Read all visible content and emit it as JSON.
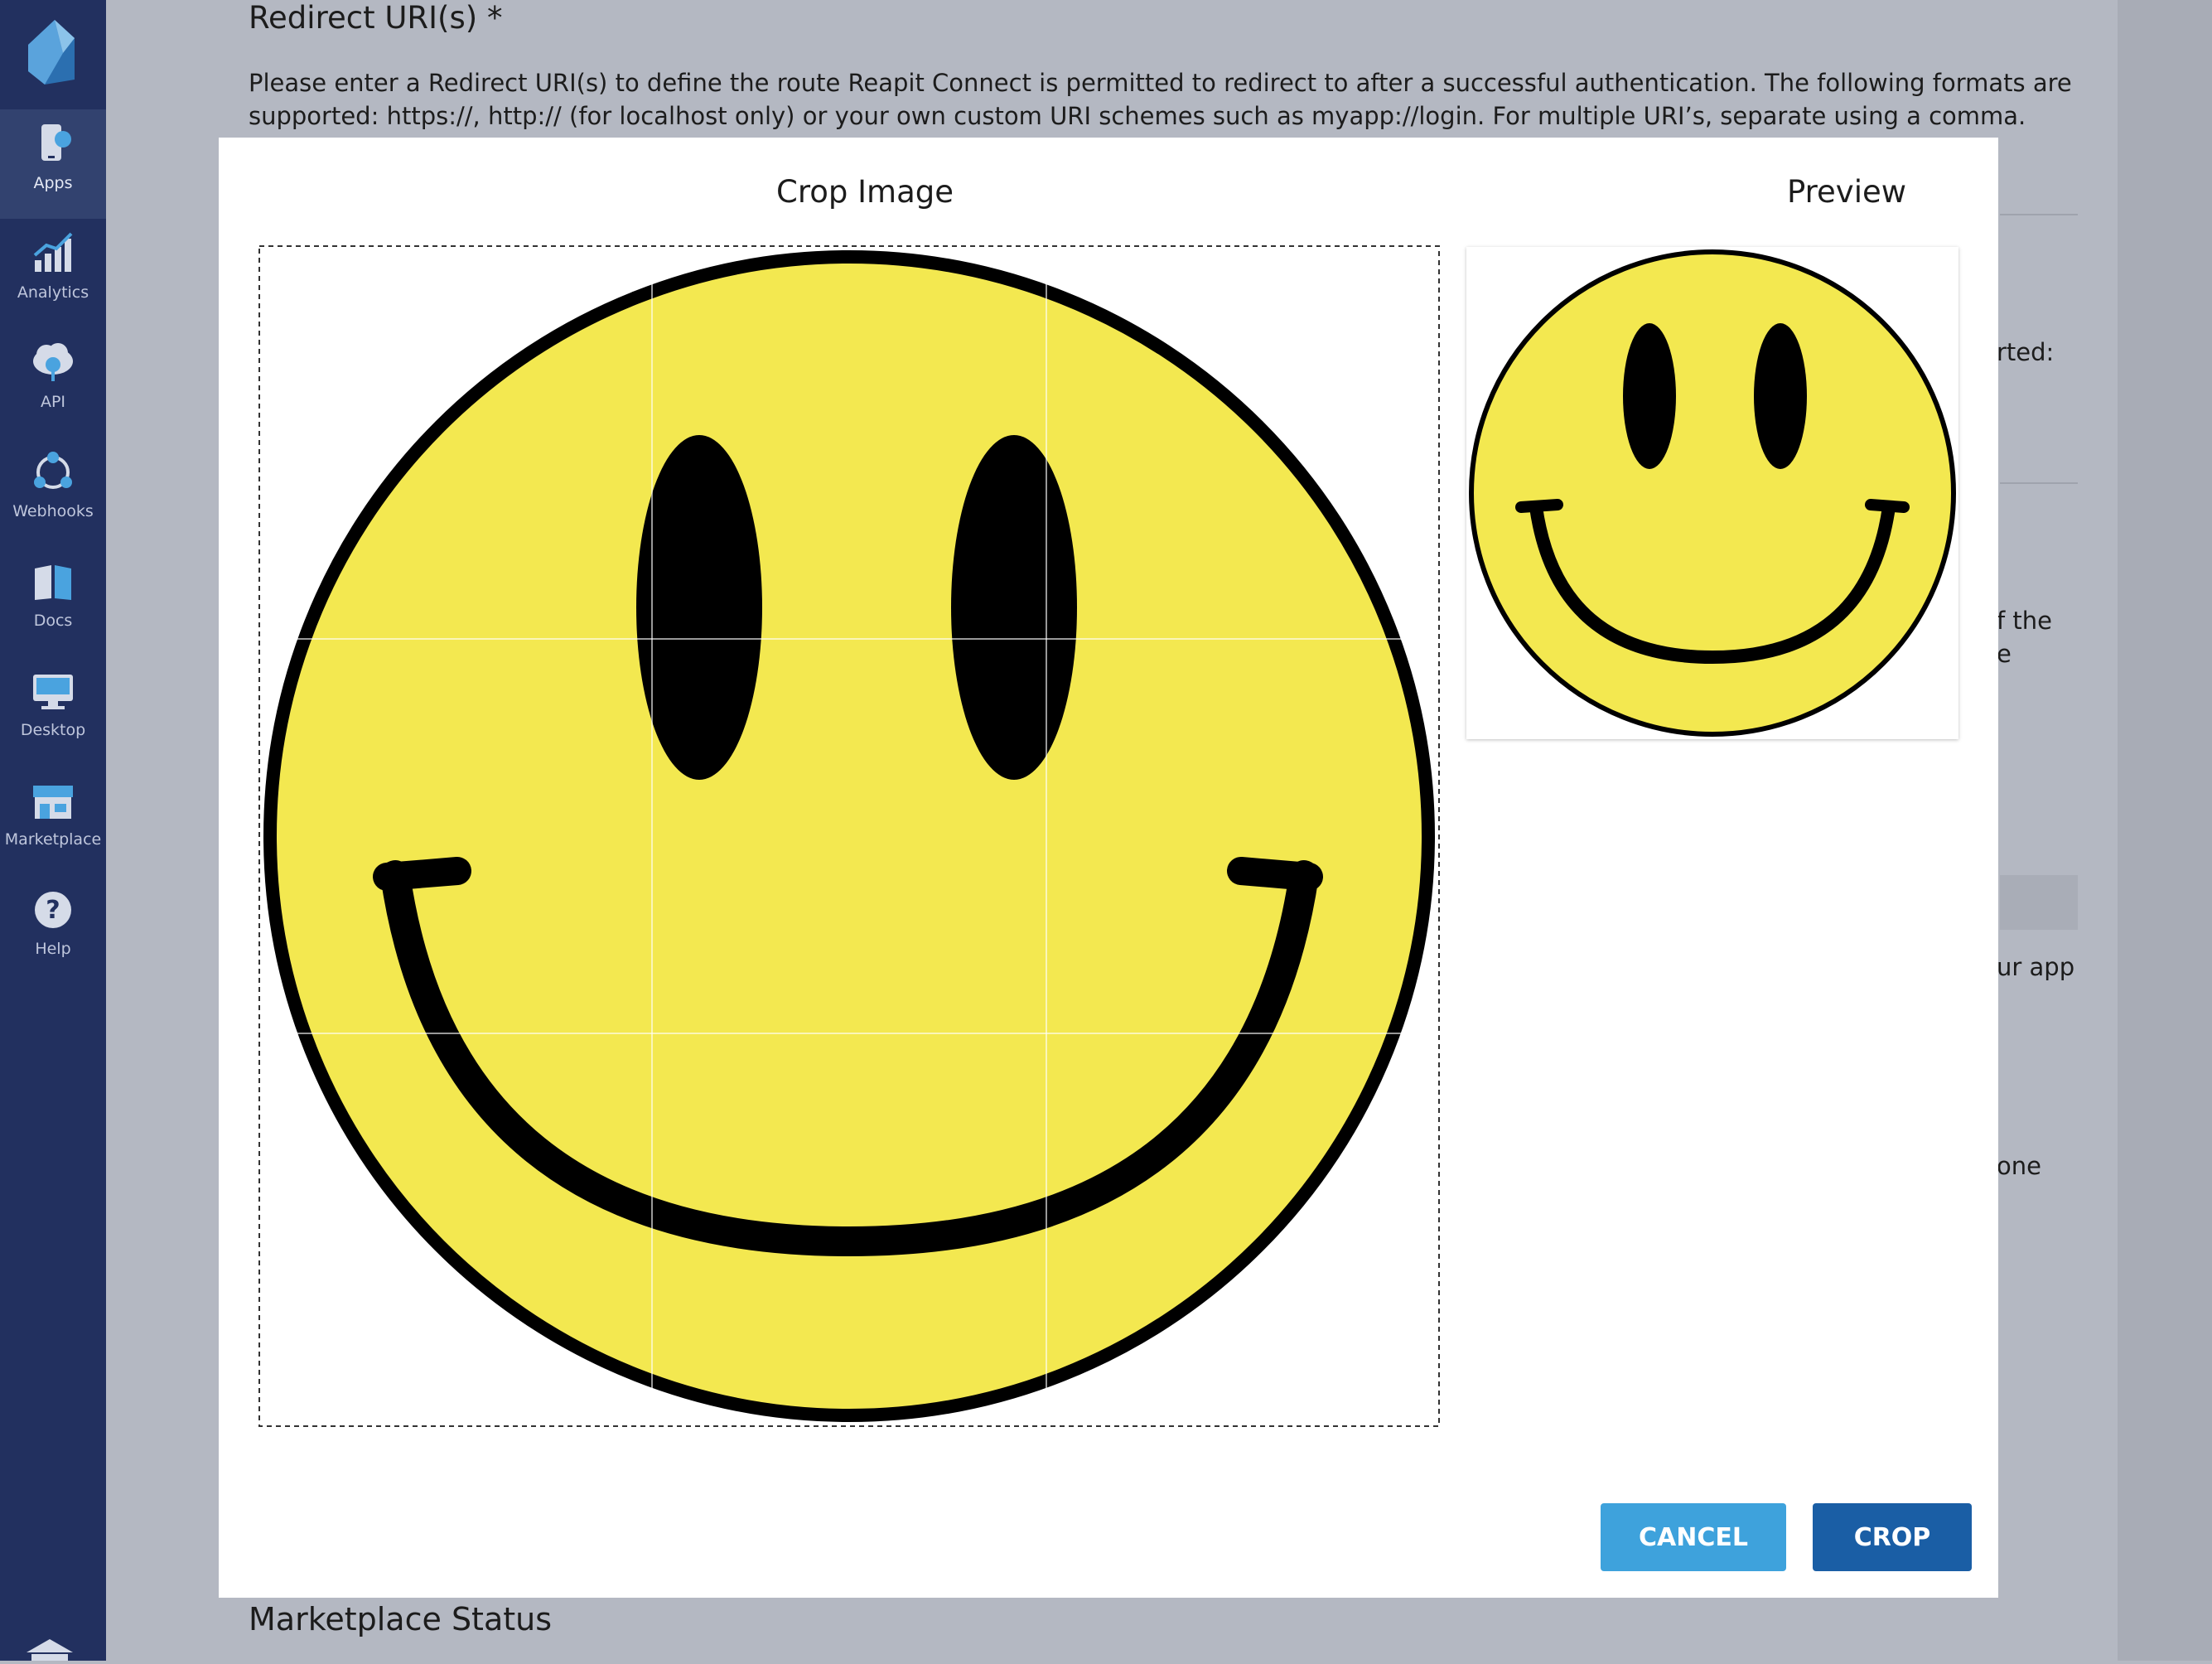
{
  "sidebar": {
    "items": [
      {
        "label": "Apps",
        "icon": "apps-icon"
      },
      {
        "label": "Analytics",
        "icon": "analytics-icon"
      },
      {
        "label": "API",
        "icon": "api-cloud-icon"
      },
      {
        "label": "Webhooks",
        "icon": "webhooks-icon"
      },
      {
        "label": "Docs",
        "icon": "docs-book-icon"
      },
      {
        "label": "Desktop",
        "icon": "desktop-icon"
      },
      {
        "label": "Marketplace",
        "icon": "marketplace-store-icon"
      },
      {
        "label": "Help",
        "icon": "help-icon"
      }
    ],
    "active_item": "Apps"
  },
  "background": {
    "heading": "Redirect URI(s) *",
    "paragraph": "Please enter a Redirect URI(s) to define the route Reapit Connect is permitted to redirect to after a successful authentication. The following formats are supported: https://, http:// (for localhost only) or your own custom URI schemes such as myapp://login. For multiple URI’s, separate using a comma.",
    "fragments": [
      "rted:",
      "f the",
      "e",
      "ur app",
      "one"
    ],
    "bottom_heading": "Marketplace Status"
  },
  "modal": {
    "crop_title": "Crop Image",
    "preview_title": "Preview",
    "cancel_label": "CANCEL",
    "crop_label": "CROP"
  },
  "colors": {
    "sidebar_bg": "#22305f",
    "sidebar_active": "#32426f",
    "smiley_yellow": "#f3e850",
    "cancel_button": "#3ea2dc",
    "crop_button": "#1a5ea5"
  }
}
